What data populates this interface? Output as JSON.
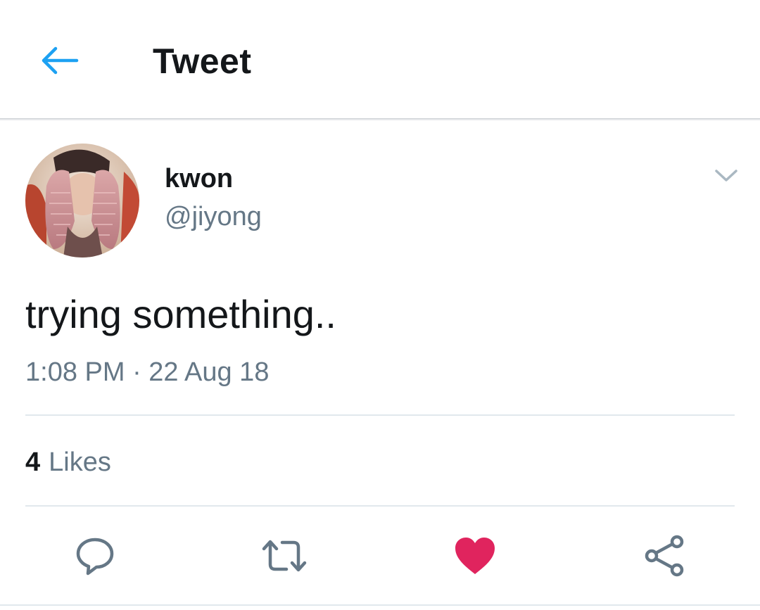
{
  "header": {
    "title": "Tweet",
    "back_icon": "arrow-left-icon",
    "accent_color": "#1da1f2"
  },
  "tweet": {
    "author": {
      "name": "kwon",
      "handle": "@jiyong",
      "avatar": "profile-photo"
    },
    "text": "trying something..",
    "timestamp": "1:08 PM · 22 Aug 18",
    "stats": {
      "likes_count": "4",
      "likes_label": "Likes"
    },
    "liked": true
  },
  "actions": [
    {
      "name": "reply",
      "icon": "reply-icon"
    },
    {
      "name": "retweet",
      "icon": "retweet-icon"
    },
    {
      "name": "like",
      "icon": "heart-icon",
      "color": "#e0245e"
    },
    {
      "name": "share",
      "icon": "share-icon"
    }
  ],
  "colors": {
    "text_primary": "#14171a",
    "text_secondary": "#657786",
    "icon_gray": "#657786",
    "divider": "#e1e8ed",
    "like_red": "#e0245e"
  }
}
